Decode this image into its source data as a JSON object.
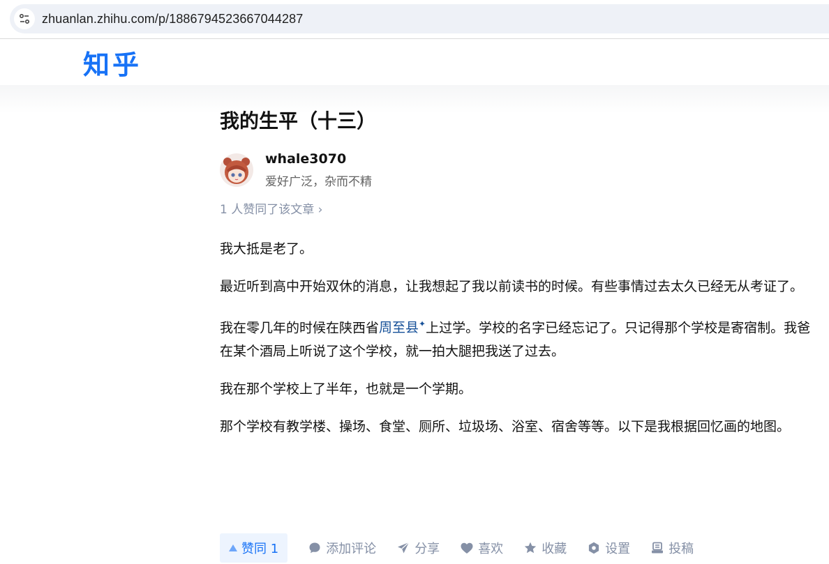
{
  "browser": {
    "url": "zhuanlan.zhihu.com/p/1886794523667044287",
    "site_info_icon": "site-settings-icon"
  },
  "header": {
    "logo": "知乎"
  },
  "article": {
    "title": "我的生平（十三）",
    "author": {
      "name": "whale3070",
      "bio": "爱好广泛，杂而不精"
    },
    "likes_summary": "1 人赞同了该文章 ›",
    "paragraphs": {
      "p1": "我大抵是老了。",
      "p2": "最近听到高中开始双休的消息，让我想起了我以前读书的时候。有些事情过去太久已经无从考证了。",
      "p3_before": "我在零几年的时候在陕西省",
      "p3_link": "周至县",
      "p3_link_mark": "✦",
      "p3_after": "上过学。学校的名字已经忘记了。只记得那个学校是寄宿制。我爸在某个酒局上听说了这个学校，就一拍大腿把我送了过去。",
      "p4": "我在那个学校上了半年，也就是一个学期。",
      "p5": "那个学校有教学楼、操场、食堂、厕所、垃圾场、浴室、宿舍等等。以下是我根据回忆画的地图。"
    }
  },
  "actions": {
    "vote": "赞同 1",
    "comment": "添加评论",
    "share": "分享",
    "like": "喜欢",
    "collect": "收藏",
    "settings": "设置",
    "submit": "投稿"
  },
  "colors": {
    "brand": "#1772f6",
    "link": "#175199",
    "muted": "#8590a6"
  }
}
